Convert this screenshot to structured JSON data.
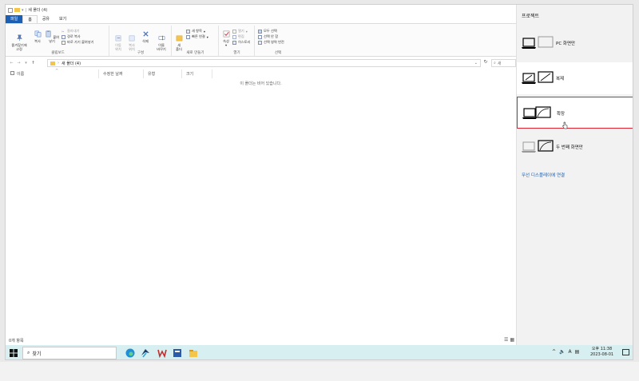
{
  "window": {
    "title": "새 폴더 (4)"
  },
  "tabs": [
    "파일",
    "홈",
    "공유",
    "보기"
  ],
  "ribbon": {
    "clipboard": {
      "pin_label": "즐겨찾기에\n고정",
      "copy_label": "복사",
      "paste_label": "붙여넣기",
      "cut_label": "잘라내기",
      "copy_path_label": "경로 복사",
      "paste_shortcut_label": "바로 가기 붙여넣기",
      "group_label": "클립보드"
    },
    "organize": {
      "move_label": "이동\n위치",
      "copy_to_label": "복사\n위치",
      "delete_label": "삭제",
      "rename_label": "이름\n바꾸기",
      "group_label": "구성"
    },
    "new": {
      "new_folder_label": "새\n폴더",
      "new_item_label": "새 항목",
      "easy_access_label": "빠른 연결",
      "group_label": "새로 만들기"
    },
    "open": {
      "properties_label": "속성",
      "open_label": "열기",
      "edit_label": "편집",
      "history_label": "히스토리",
      "group_label": "열기"
    },
    "select": {
      "select_all_label": "모두 선택",
      "select_none_label": "선택 안 함",
      "invert_label": "선택 영역 반전",
      "group_label": "선택"
    }
  },
  "address": {
    "path": "새 폴더 (4)",
    "search_placeholder": "새"
  },
  "columns": [
    "이름",
    "수정한 날짜",
    "유형",
    "크기"
  ],
  "empty_message": "이 폴더는 비어 있습니다.",
  "status": {
    "item_count": "0개 항목"
  },
  "project": {
    "title": "프로젝트",
    "options": [
      {
        "label": "PC 화면만"
      },
      {
        "label": "복제"
      },
      {
        "label": "확장"
      },
      {
        "label": "두 번째 화면만"
      }
    ],
    "selected_index": 2,
    "wireless_link": "무선 디스플레이에 연결"
  },
  "taskbar": {
    "search_label": "찾기",
    "tray_lang": "A",
    "time": "오후 11:38",
    "date": "2023-08-01"
  },
  "colors": {
    "accent": "#1a5fb4",
    "selection": "#e0212f",
    "taskbar": "#d7eff0"
  }
}
